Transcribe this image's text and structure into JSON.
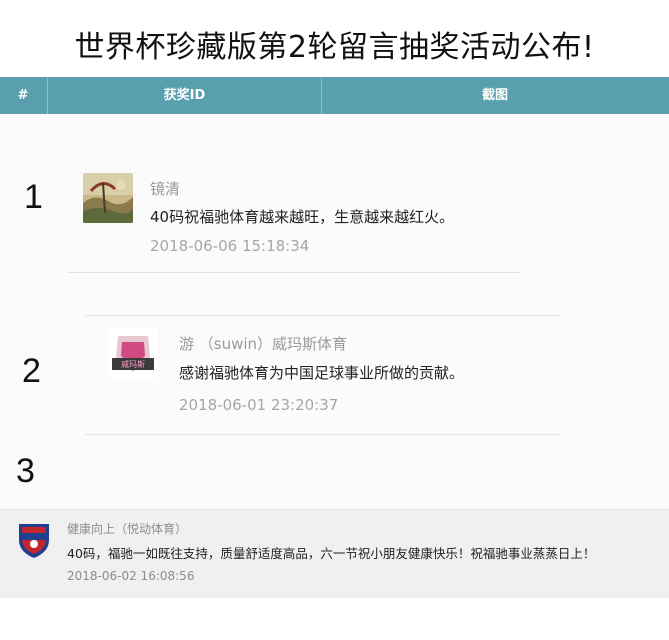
{
  "title": "世界杯珍藏版第2轮留言抽奖活动公布!",
  "table": {
    "headers": [
      "#",
      "获奖ID",
      "截图"
    ]
  },
  "rows": [
    {
      "number": "1",
      "name": "镜清",
      "message": "40码祝福驰体育越来越旺，生意越来越红火。",
      "time": "2018-06-06 15:18:34"
    },
    {
      "number": "2",
      "name": "游 （suwin）威玛斯体育",
      "message": "感谢福驰体育为中国足球事业所做的贡献。",
      "time": "2018-06-01 23:20:37"
    },
    {
      "number": "3",
      "name": "健康向上（悦动体育）",
      "message": "40码，福驰一如既往支持，质量舒适度高品，六一节祝小朋友健康快乐！祝福驰事业蒸蒸日上！",
      "time": "2018-06-02 16:08:56"
    }
  ],
  "colors": {
    "header_bg": "#5a9fad",
    "header_text": "#ffffff"
  },
  "icons": {
    "row1_avatar": "landscape-painting-avatar",
    "row2_avatar": "pink-logo-avatar",
    "row3_avatar": "shield-badge-avatar"
  }
}
